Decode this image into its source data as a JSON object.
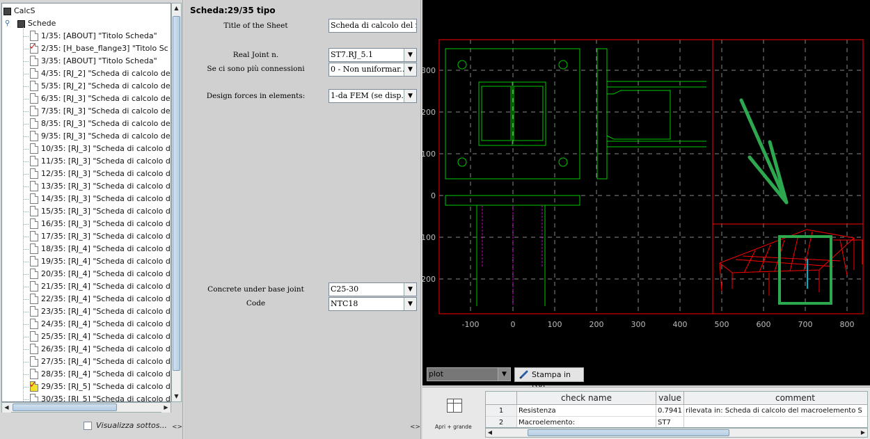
{
  "tree": {
    "root_label": "CalcS",
    "group_label": "Schede",
    "items": [
      {
        "label": "1/35: [ABOUT] \"Titolo Scheda\"",
        "mark": "none"
      },
      {
        "label": "2/35: [H_base_flange3] \"Titolo Sc",
        "mark": "check-red"
      },
      {
        "label": "3/35: [ABOUT] \"Titolo Scheda\"",
        "mark": "none"
      },
      {
        "label": "4/35: [RJ_2] \"Scheda di calcolo de",
        "mark": "none"
      },
      {
        "label": "5/35: [RJ_2] \"Scheda di calcolo de",
        "mark": "none"
      },
      {
        "label": "6/35: [RJ_3] \"Scheda di calcolo de",
        "mark": "none"
      },
      {
        "label": "7/35: [RJ_3] \"Scheda di calcolo de",
        "mark": "none"
      },
      {
        "label": "8/35: [RJ_3] \"Scheda di calcolo de",
        "mark": "none"
      },
      {
        "label": "9/35: [RJ_3] \"Scheda di calcolo de",
        "mark": "none"
      },
      {
        "label": "10/35: [RJ_3] \"Scheda di calcolo d",
        "mark": "none"
      },
      {
        "label": "11/35: [RJ_3] \"Scheda di calcolo d",
        "mark": "none"
      },
      {
        "label": "12/35: [RJ_3] \"Scheda di calcolo d",
        "mark": "none"
      },
      {
        "label": "13/35: [RJ_3] \"Scheda di calcolo d",
        "mark": "none"
      },
      {
        "label": "14/35: [RJ_3] \"Scheda di calcolo d",
        "mark": "none"
      },
      {
        "label": "15/35: [RJ_3] \"Scheda di calcolo d",
        "mark": "none"
      },
      {
        "label": "16/35: [RJ_3] \"Scheda di calcolo d",
        "mark": "none"
      },
      {
        "label": "17/35: [RJ_3] \"Scheda di calcolo d",
        "mark": "none"
      },
      {
        "label": "18/35: [RJ_4] \"Scheda di calcolo d",
        "mark": "none"
      },
      {
        "label": "19/35: [RJ_4] \"Scheda di calcolo d",
        "mark": "none"
      },
      {
        "label": "20/35: [RJ_4] \"Scheda di calcolo d",
        "mark": "none"
      },
      {
        "label": "21/35: [RJ_4] \"Scheda di calcolo d",
        "mark": "none"
      },
      {
        "label": "22/35: [RJ_4] \"Scheda di calcolo d",
        "mark": "none"
      },
      {
        "label": "23/35: [RJ_4] \"Scheda di calcolo d",
        "mark": "none"
      },
      {
        "label": "24/35: [RJ_4] \"Scheda di calcolo d",
        "mark": "none"
      },
      {
        "label": "25/35: [RJ_4] \"Scheda di calcolo d",
        "mark": "none"
      },
      {
        "label": "26/35: [RJ_4] \"Scheda di calcolo d",
        "mark": "none"
      },
      {
        "label": "27/35: [RJ_4] \"Scheda di calcolo d",
        "mark": "none"
      },
      {
        "label": "28/35: [RJ_4] \"Scheda di calcolo d",
        "mark": "none"
      },
      {
        "label": "29/35: [RJ_5] \"Scheda di calcolo d",
        "mark": "check-yellow"
      },
      {
        "label": "30/35: [RJ_5] \"Scheda di calcolo d",
        "mark": "none"
      }
    ],
    "show_sub_label": "Visualizza sottos...",
    "expand_glyph": "<>"
  },
  "form": {
    "title": "Scheda:29/35 tipo",
    "fields": {
      "title_label": "Title of the Sheet",
      "title_value": "Scheda di calcolo del m",
      "real_joint_label": "Real Joint n.",
      "real_joint_value": "ST7.RJ_5.1",
      "connections_label": "Se ci sono più connessioni",
      "connections_value": "0 - Non uniformar...",
      "design_forces_label": "Design forces in elements:",
      "design_forces_value": "1-da FEM (se disp.)",
      "concrete_label": "Concrete under base joint",
      "concrete_value": "C25-30",
      "code_label": "Code",
      "code_value": "NTC18"
    },
    "expand_glyph": "<>"
  },
  "plot": {
    "x_ticks": [
      "-100",
      "0",
      "100",
      "200",
      "300",
      "400",
      "500",
      "600",
      "700",
      "800"
    ],
    "y_ticks": [
      "300",
      "200",
      "100",
      "0",
      "-100",
      "-200"
    ],
    "select_value": "plot",
    "dxf_button_label": "Stampa in DXF",
    "colors": {
      "frame": "#ff0000",
      "steel": "#00c800",
      "bolt": "#c800c8",
      "grid": "#8a8a8a",
      "highlight": "#2ea84f",
      "member": "#00b0c8"
    }
  },
  "results": {
    "grid_button_label": "Apri + grande",
    "columns": [
      "check name",
      "value",
      "comment"
    ],
    "rows": [
      {
        "num": "1",
        "check": "Resistenza",
        "value": "0.7941",
        "comment": "rilevata in: Scheda di calcolo del macroelemento S"
      },
      {
        "num": "2",
        "check": "Macroelemento:",
        "value": "ST7",
        "comment": ""
      }
    ]
  }
}
